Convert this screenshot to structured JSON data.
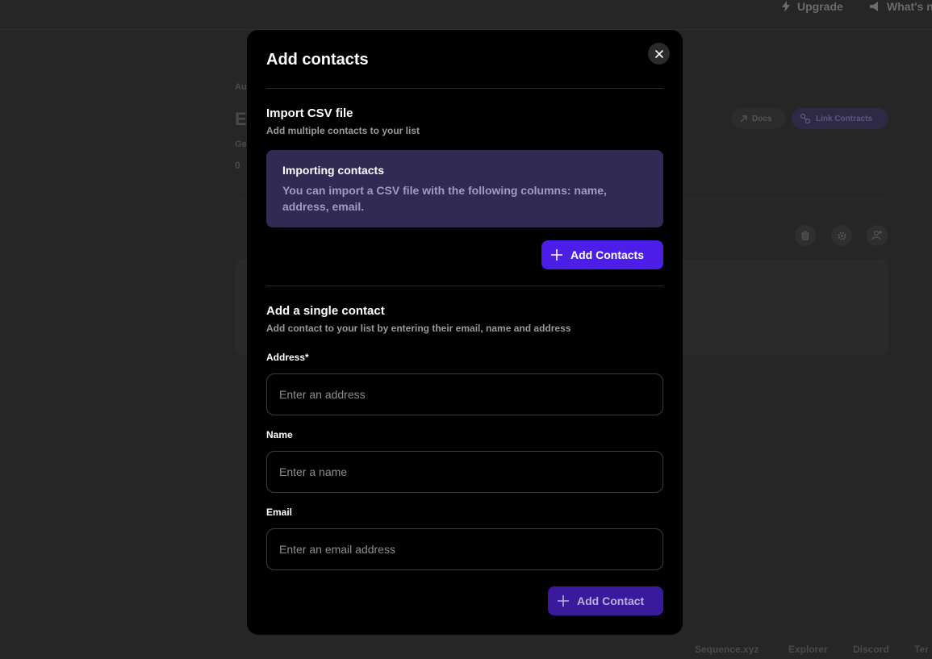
{
  "background": {
    "topbar": {
      "upgrade_label": "Upgrade",
      "whats_new_label": "What's n"
    },
    "breadcrumb_fragment": "Au",
    "title_fragment": "E",
    "subtitle_fragment": "Ge",
    "count_fragment": "0",
    "docs_label": "Docs",
    "link_contracts_label": "Link Contracts",
    "footer": {
      "link1": "Sequence.xyz",
      "link2": "Explorer",
      "link3": "Discord",
      "link4": "Ter"
    }
  },
  "modal": {
    "title": "Add contacts",
    "csv_section": {
      "title": "Import CSV file",
      "subtitle": "Add multiple contacts to your list",
      "info_title": "Importing contacts",
      "info_text": "You can import a CSV file with the following columns: name, address, email.",
      "button_label": "Add Contacts"
    },
    "single_section": {
      "title": "Add a single contact",
      "subtitle": "Add contact to your list by entering their email, name and address",
      "address_label": "Address*",
      "address_placeholder": "Enter an address",
      "name_label": "Name",
      "name_placeholder": "Enter a name",
      "email_label": "Email",
      "email_placeholder": "Enter an email address",
      "button_label": "Add Contact"
    }
  },
  "colors": {
    "accent": "#4d1ee8",
    "info_box": "#302a55",
    "backdrop": "#262626"
  }
}
